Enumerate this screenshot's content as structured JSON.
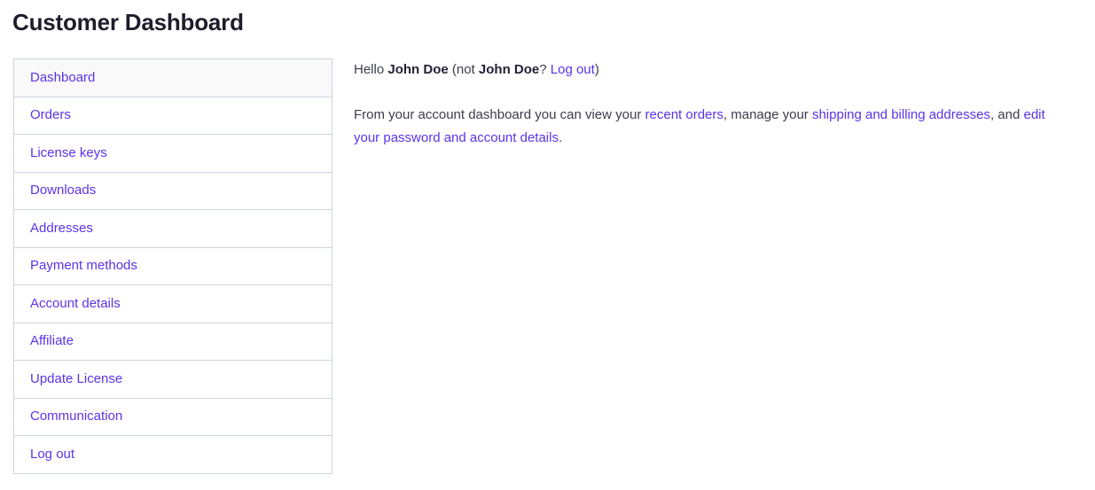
{
  "page": {
    "title": "Customer Dashboard"
  },
  "colors": {
    "link": "#5b33e8",
    "title_text": "#1d1d2c",
    "body_text": "#3c3c4c",
    "border": "#ccd4e0",
    "active_row_background": "#f9f9fa"
  },
  "sidebar": {
    "items": [
      {
        "label": "Dashboard",
        "active": true
      },
      {
        "label": "Orders",
        "active": false
      },
      {
        "label": "License keys",
        "active": false
      },
      {
        "label": "Downloads",
        "active": false
      },
      {
        "label": "Addresses",
        "active": false
      },
      {
        "label": "Payment methods",
        "active": false
      },
      {
        "label": "Account details",
        "active": false
      },
      {
        "label": "Affiliate",
        "active": false
      },
      {
        "label": "Update License",
        "active": false
      },
      {
        "label": "Communication",
        "active": false
      },
      {
        "label": "Log out",
        "active": false
      }
    ]
  },
  "main": {
    "greeting": {
      "hello": "Hello",
      "user_name": "John Doe",
      "not_prefix": "(not",
      "not_user_name": "John Doe",
      "question_mark": "?",
      "logout_link": "Log out",
      "close_paren": ")"
    },
    "intro": {
      "lead": "From your account dashboard you can view your",
      "recent_orders_link": "recent orders",
      "comma_manage": ", manage your",
      "addresses_link": "shipping and billing addresses",
      "comma_and": ", and",
      "account_details_link": "edit your password and account details",
      "period": "."
    }
  }
}
